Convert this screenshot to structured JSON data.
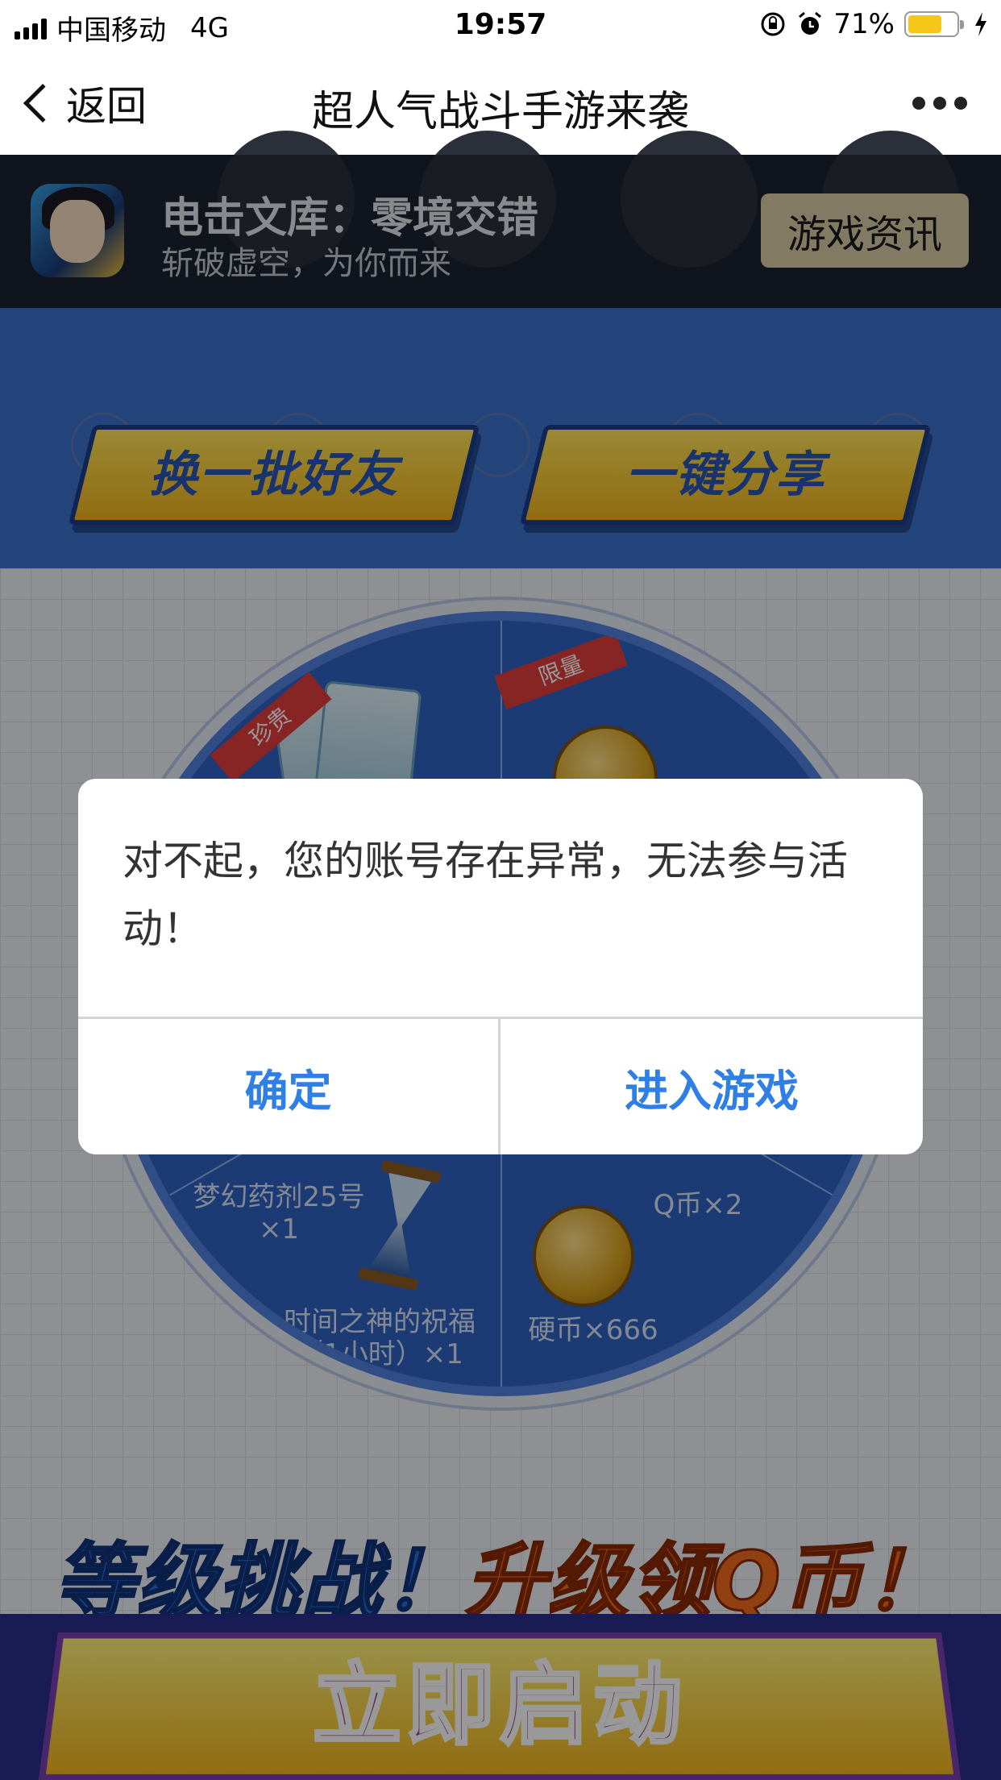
{
  "status_bar": {
    "carrier": "中国移动",
    "network": "4G",
    "time": "19:57",
    "battery": "71%",
    "battery_level": 0.71
  },
  "nav": {
    "back_label": "返回",
    "title": "超人气战斗手游来袭"
  },
  "game_header": {
    "title": "电击文库：零境交错",
    "subtitle": "斩破虚空，为你而来",
    "button": "游戏资讯"
  },
  "actions": {
    "refresh_friends": "换一批好友",
    "share": "一键分享"
  },
  "wheel": {
    "ribbon_1": "珍贵",
    "ribbon_2": "限量",
    "prizes": [
      {
        "name": "梦幻药剂25号",
        "qty": "×1"
      },
      {
        "name": "时间之神的祝福",
        "qty": "（1小时）×1"
      },
      {
        "name": "硬币×666",
        "qty": ""
      },
      {
        "name": "Q币×2",
        "qty": ""
      }
    ]
  },
  "banner": {
    "part1": "等级挑战！",
    "part2": "升级领Q币！"
  },
  "start_button": "立即启动",
  "dialog": {
    "message": "对不起，您的账号存在异常，无法参与活动！",
    "confirm": "确定",
    "enter_game": "进入游戏"
  },
  "colors": {
    "primary_blue": "#3d72cf",
    "dialog_button": "#2f7fe6",
    "battery": "#f5c518"
  }
}
